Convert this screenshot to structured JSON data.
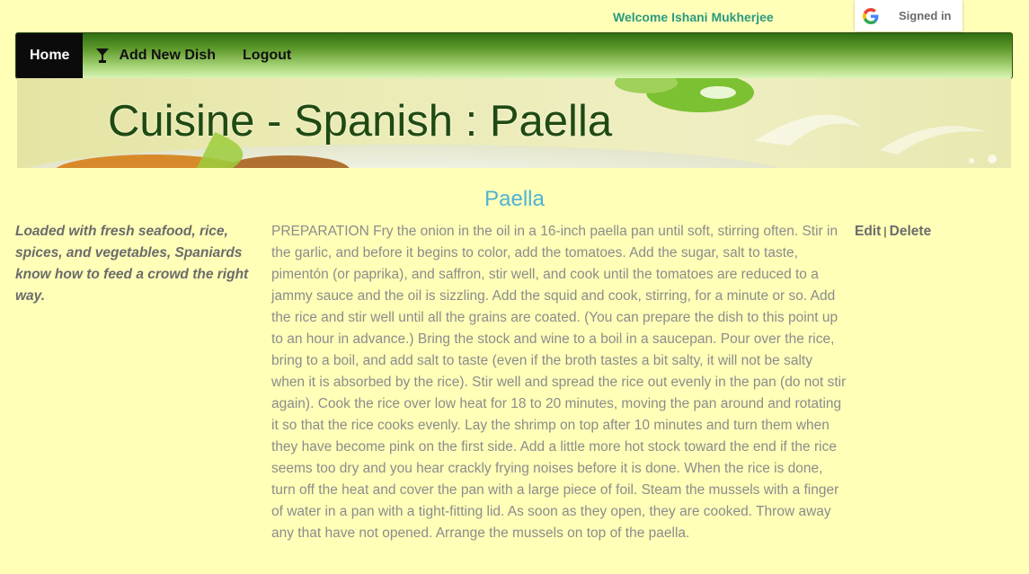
{
  "header": {
    "welcome": "Welcome Ishani Mukherjee",
    "google_signin_label": "Signed in"
  },
  "nav": {
    "items": [
      {
        "label": "Home",
        "active": true
      },
      {
        "label": "Add New Dish",
        "icon": "cocktail-icon"
      },
      {
        "label": "Logout"
      }
    ]
  },
  "banner": {
    "title": "Cuisine - Spanish : Paella"
  },
  "dish": {
    "name": "Paella",
    "description": "Loaded with fresh seafood, rice, spices, and vegetables, Spaniards know how to feed a crowd the right way.",
    "preparation": "PREPARATION Fry the onion in the oil in a 16-inch paella pan until soft, stirring often. Stir in the garlic, and before it begins to color, add the tomatoes. Add the sugar, salt to taste, pimentón (or paprika), and saffron, stir well, and cook until the tomatoes are reduced to a jammy sauce and the oil is sizzling. Add the squid and cook, stirring, for a minute or so. Add the rice and stir well until all the grains are coated. (You can prepare the dish to this point up to an hour in advance.) Bring the stock and wine to a boil in a saucepan. Pour over the rice, bring to a boil, and add salt to taste (even if the broth tastes a bit salty, it will not be salty when it is absorbed by the rice). Stir well and spread the rice out evenly in the pan (do not stir again). Cook the rice over low heat for 18 to 20 minutes, moving the pan around and rotating it so that the rice cooks evenly. Lay the shrimp on top after 10 minutes and turn them when they have become pink on the first side. Add a little more hot stock toward the end if the rice seems too dry and you hear crackly frying noises before it is done. When the rice is done, turn off the heat and cover the pan with a large piece of foil. Steam the mussels with a finger of water in a pan with a tight-fitting lid. As soon as they open, they are cooked. Throw away any that have not opened. Arrange the mussels on top of the paella."
  },
  "actions": {
    "edit": "Edit",
    "separator": "|",
    "delete": "Delete"
  },
  "colors": {
    "page_background": "#ffffb8",
    "welcome_text": "#2a9a80",
    "heading": "#4fb3d6",
    "nav_active_bg": "#0b0b0b",
    "banner_title": "#1f4a12"
  }
}
